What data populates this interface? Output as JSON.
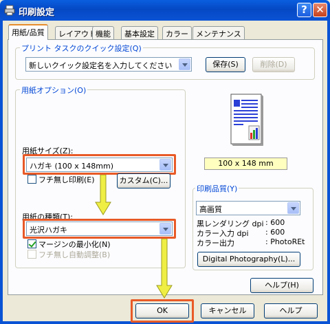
{
  "window": {
    "title": "印刷設定",
    "help_btn": "?",
    "close_btn": "✕"
  },
  "tabs": [
    "用紙/品質",
    "レイアウト",
    "機能",
    "基本設定",
    "カラー",
    "メンテナンス"
  ],
  "quick": {
    "label": "プリント タスクのクイック設定(Q)",
    "combo": "新しいクイック設定名を入力してください",
    "save": "保存(S)",
    "delete": "削除(D)"
  },
  "paper_options": {
    "label": "用紙オプション(O)",
    "size_label": "用紙サイズ(Z):",
    "size_value": "ハガキ (100 x 148mm)",
    "borderless": "フチ無し印刷(E)",
    "custom": "カスタム(C)...",
    "type_label": "用紙の種類(T):",
    "type_value": "光沢ハガキ",
    "min_margin": "マージンの最小化(N)",
    "auto_adjust": "フチ無し自動調整(B)"
  },
  "preview": {
    "size_text": "100 x 148 mm"
  },
  "quality": {
    "label": "印刷品質(Y)",
    "value": "高画質",
    "rows": [
      {
        "name": "黒レンダリング dpi",
        "value": ": 600"
      },
      {
        "name": "カラー入力 dpi",
        "value": ": 600"
      },
      {
        "name": "カラー出力",
        "value": ": PhotoREt"
      }
    ],
    "photo_btn": "Digital Photography(L)..."
  },
  "panel_help": "ヘルプ(H)",
  "footer": {
    "ok": "OK",
    "cancel": "キャンセル",
    "help": "ヘルプ"
  },
  "colors": {
    "highlight": "#e85a27",
    "arrow": "#eeee44",
    "titlebar": "#0a53d4"
  }
}
